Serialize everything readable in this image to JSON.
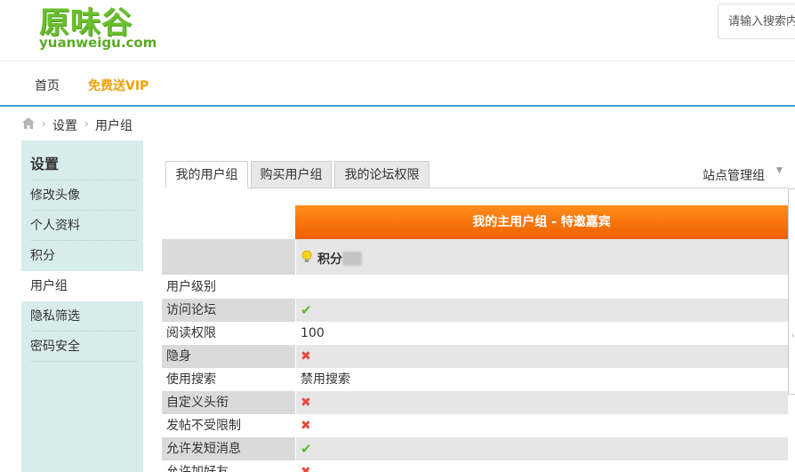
{
  "header": {
    "logo_cn": "原味谷",
    "logo_en": "yuanweigu.com",
    "search_placeholder": "请输入搜索内容"
  },
  "nav": {
    "home": "首页",
    "vip": "免费送VIP"
  },
  "breadcrumb": {
    "sep": "›",
    "items": [
      "设置",
      "用户组"
    ]
  },
  "sidebar": {
    "title": "设置",
    "items": [
      {
        "label": "修改头像",
        "active": false
      },
      {
        "label": "个人资料",
        "active": false
      },
      {
        "label": "积分",
        "active": false
      },
      {
        "label": "用户组",
        "active": true
      },
      {
        "label": "隐私筛选",
        "active": false
      },
      {
        "label": "密码安全",
        "active": false
      }
    ]
  },
  "tabs": [
    {
      "label": "我的用户组",
      "active": true
    },
    {
      "label": "购买用户组",
      "active": false
    },
    {
      "label": "我的论坛权限",
      "active": false
    }
  ],
  "site_admin": "站点管理组",
  "site_admin_arrow": "▼",
  "group": {
    "header": "我的主用户组 - 特邀嘉宾",
    "score_label": "积分"
  },
  "permissions": [
    {
      "label": "用户级别",
      "value": "",
      "status": "none"
    },
    {
      "label": "访问论坛",
      "value": "",
      "status": "yes"
    },
    {
      "label": "阅读权限",
      "value": "100",
      "status": "text"
    },
    {
      "label": "隐身",
      "value": "",
      "status": "no"
    },
    {
      "label": "使用搜索",
      "value": "禁用搜索",
      "status": "text"
    },
    {
      "label": "自定义头衔",
      "value": "",
      "status": "no"
    },
    {
      "label": "发帖不受限制",
      "value": "",
      "status": "no"
    },
    {
      "label": "允许发短消息",
      "value": "",
      "status": "yes"
    },
    {
      "label": "允许加好友",
      "value": "",
      "status": "no"
    }
  ],
  "icons": {
    "yes": "✔",
    "no": "✖"
  },
  "colors": {
    "accent_blue": "#4aa3c8",
    "vip_orange": "#f2a10f",
    "header_orange": "#f06000",
    "logo_green": "#6abf2e",
    "sidebar_bg": "#d8ecec"
  }
}
